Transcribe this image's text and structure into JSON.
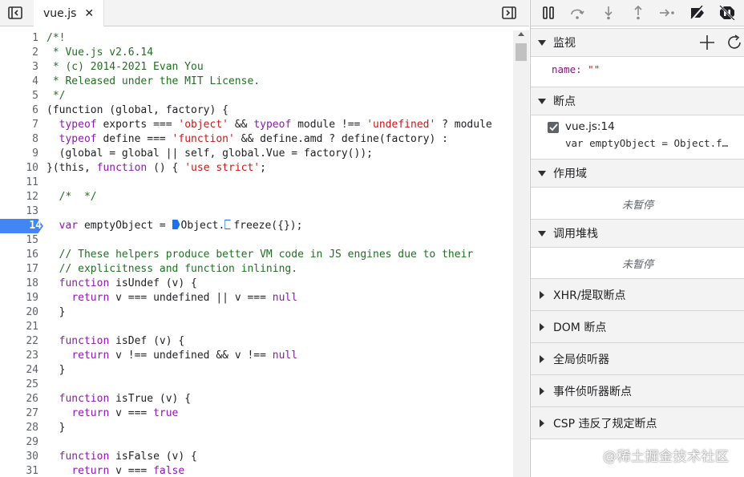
{
  "editor": {
    "tab_label": "vue.js",
    "tab_close": "✕",
    "lines": [
      {
        "n": "1",
        "tokens": [
          [
            "c",
            "/*!"
          ]
        ]
      },
      {
        "n": "2",
        "tokens": [
          [
            "c",
            " * Vue.js v2.6.14"
          ]
        ]
      },
      {
        "n": "3",
        "tokens": [
          [
            "c",
            " * (c) 2014-2021 Evan You"
          ]
        ]
      },
      {
        "n": "4",
        "tokens": [
          [
            "c",
            " * Released under the MIT License."
          ]
        ]
      },
      {
        "n": "5",
        "tokens": [
          [
            "c",
            " */"
          ]
        ]
      },
      {
        "n": "6",
        "tokens": [
          [
            "p",
            "(function (global, factory) {"
          ]
        ]
      },
      {
        "n": "7",
        "tokens": [
          [
            "p",
            "  "
          ],
          [
            "k",
            "typeof"
          ],
          [
            "p",
            " exports === "
          ],
          [
            "s",
            "'object'"
          ],
          [
            "p",
            " && "
          ],
          [
            "k",
            "typeof"
          ],
          [
            "p",
            " module !== "
          ],
          [
            "s",
            "'undefined'"
          ],
          [
            "p",
            " ? module"
          ]
        ]
      },
      {
        "n": "8",
        "tokens": [
          [
            "p",
            "  "
          ],
          [
            "k",
            "typeof"
          ],
          [
            "p",
            " define === "
          ],
          [
            "s",
            "'function'"
          ],
          [
            "p",
            " && define.amd ? define(factory) :"
          ]
        ]
      },
      {
        "n": "9",
        "tokens": [
          [
            "p",
            "  (global = global || self, global.Vue = factory());"
          ]
        ]
      },
      {
        "n": "10",
        "tokens": [
          [
            "p",
            "}(this, "
          ],
          [
            "k",
            "function"
          ],
          [
            "p",
            " () { "
          ],
          [
            "s",
            "'use strict'"
          ],
          [
            "p",
            ";"
          ]
        ]
      },
      {
        "n": "11",
        "tokens": []
      },
      {
        "n": "12",
        "tokens": [
          [
            "p",
            "  "
          ],
          [
            "c",
            "/*  */"
          ]
        ]
      },
      {
        "n": "13",
        "tokens": []
      },
      {
        "n": "14",
        "breakpoint": true,
        "tokens": [
          [
            "p",
            "  "
          ],
          [
            "k",
            "var"
          ],
          [
            "p",
            " emptyObject = "
          ],
          [
            "m1",
            ""
          ],
          [
            "p",
            "Object."
          ],
          [
            "m2",
            ""
          ],
          [
            "p",
            "freeze({});"
          ]
        ]
      },
      {
        "n": "15",
        "tokens": []
      },
      {
        "n": "16",
        "tokens": [
          [
            "p",
            "  "
          ],
          [
            "c",
            "// These helpers produce better VM code in JS engines due to their"
          ]
        ]
      },
      {
        "n": "17",
        "tokens": [
          [
            "p",
            "  "
          ],
          [
            "c",
            "// explicitness and function inlining."
          ]
        ]
      },
      {
        "n": "18",
        "tokens": [
          [
            "p",
            "  "
          ],
          [
            "k",
            "function"
          ],
          [
            "p",
            " isUndef (v) {"
          ]
        ]
      },
      {
        "n": "19",
        "tokens": [
          [
            "p",
            "    "
          ],
          [
            "k",
            "return"
          ],
          [
            "p",
            " v === undefined || v === "
          ],
          [
            "k",
            "null"
          ]
        ]
      },
      {
        "n": "20",
        "tokens": [
          [
            "p",
            "  }"
          ]
        ]
      },
      {
        "n": "21",
        "tokens": []
      },
      {
        "n": "22",
        "tokens": [
          [
            "p",
            "  "
          ],
          [
            "k",
            "function"
          ],
          [
            "p",
            " isDef (v) {"
          ]
        ]
      },
      {
        "n": "23",
        "tokens": [
          [
            "p",
            "    "
          ],
          [
            "k",
            "return"
          ],
          [
            "p",
            " v !== undefined && v !== "
          ],
          [
            "k",
            "null"
          ]
        ]
      },
      {
        "n": "24",
        "tokens": [
          [
            "p",
            "  }"
          ]
        ]
      },
      {
        "n": "25",
        "tokens": []
      },
      {
        "n": "26",
        "tokens": [
          [
            "p",
            "  "
          ],
          [
            "k",
            "function"
          ],
          [
            "p",
            " isTrue (v) {"
          ]
        ]
      },
      {
        "n": "27",
        "tokens": [
          [
            "p",
            "    "
          ],
          [
            "k",
            "return"
          ],
          [
            "p",
            " v === "
          ],
          [
            "k",
            "true"
          ]
        ]
      },
      {
        "n": "28",
        "tokens": [
          [
            "p",
            "  }"
          ]
        ]
      },
      {
        "n": "29",
        "tokens": []
      },
      {
        "n": "30",
        "tokens": [
          [
            "p",
            "  "
          ],
          [
            "k",
            "function"
          ],
          [
            "p",
            " isFalse (v) {"
          ]
        ]
      },
      {
        "n": "31",
        "tokens": [
          [
            "p",
            "    "
          ],
          [
            "k",
            "return"
          ],
          [
            "p",
            " v === "
          ],
          [
            "k",
            "false"
          ]
        ]
      }
    ]
  },
  "sidebar": {
    "watch": {
      "title": "监视",
      "item_key": "name:",
      "item_value": "\"\""
    },
    "breakpoints": {
      "title": "断点",
      "item_file": "vue.js:14",
      "item_code": "var emptyObject = Object.f…"
    },
    "scope": {
      "title": "作用域",
      "status": "未暂停"
    },
    "call_stack": {
      "title": "调用堆栈",
      "status": "未暂停"
    },
    "collapsed_sections": [
      {
        "title": "XHR/提取断点"
      },
      {
        "title": "DOM 断点"
      },
      {
        "title": "全局侦听器"
      },
      {
        "title": "事件侦听器断点"
      },
      {
        "title": "CSP 违反了规定断点"
      }
    ]
  },
  "watermark": "@稀土掘金技术社区",
  "colors": {
    "accent": "#1a73e8",
    "breakpoint_gutter": "#4285f4",
    "comment": "#236e25",
    "keyword": "#8d1aab",
    "string": "#c41a16"
  }
}
